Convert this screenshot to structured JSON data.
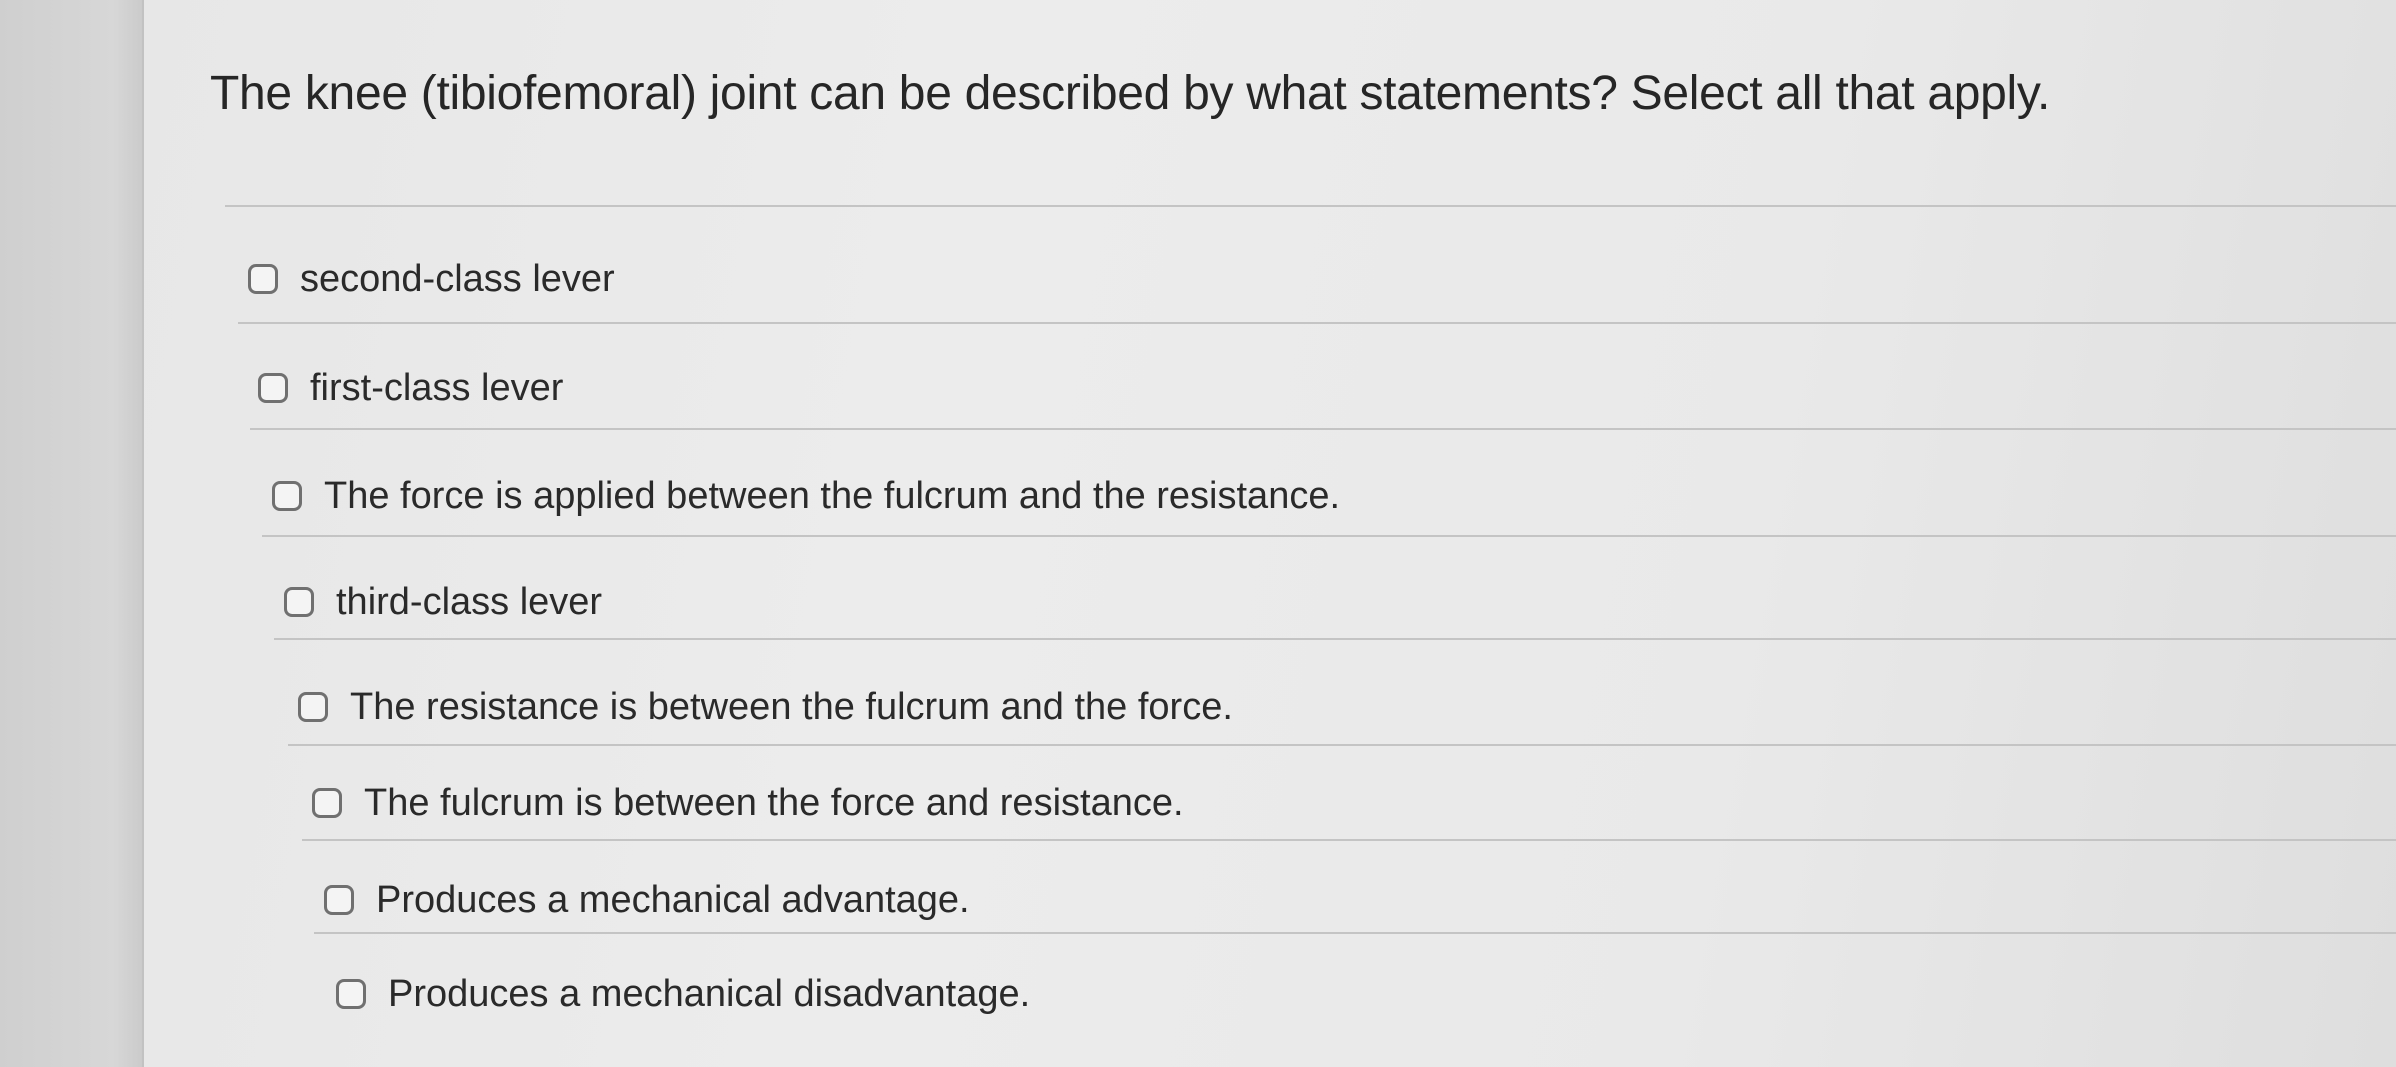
{
  "question": {
    "text": "The knee (tibiofemoral) joint can be described by what statements? Select all that apply."
  },
  "options": [
    {
      "label": "second-class lever",
      "checked": false
    },
    {
      "label": "first-class lever",
      "checked": false
    },
    {
      "label": "The force is applied between the fulcrum and the resistance.",
      "checked": false
    },
    {
      "label": "third-class lever",
      "checked": false
    },
    {
      "label": "The resistance is between the fulcrum and the force.",
      "checked": false
    },
    {
      "label": "The fulcrum is between the force and resistance.",
      "checked": false
    },
    {
      "label": "Produces a mechanical advantage.",
      "checked": false
    },
    {
      "label": "Produces a mechanical disadvantage.",
      "checked": false
    }
  ]
}
